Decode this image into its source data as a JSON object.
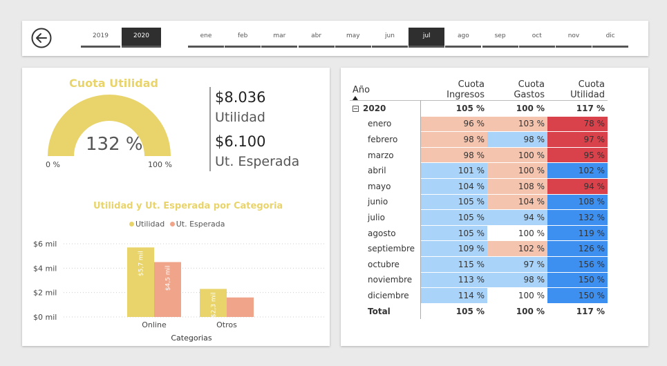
{
  "topbar": {
    "back_icon": "arrow-left-circle-icon",
    "years": [
      {
        "label": "2019",
        "selected": false
      },
      {
        "label": "2020",
        "selected": true
      }
    ],
    "months": [
      {
        "label": "ene",
        "selected": false
      },
      {
        "label": "feb",
        "selected": false
      },
      {
        "label": "mar",
        "selected": false
      },
      {
        "label": "abr",
        "selected": false
      },
      {
        "label": "may",
        "selected": false
      },
      {
        "label": "jun",
        "selected": false
      },
      {
        "label": "jul",
        "selected": true
      },
      {
        "label": "ago",
        "selected": false
      },
      {
        "label": "sep",
        "selected": false
      },
      {
        "label": "oct",
        "selected": false
      },
      {
        "label": "nov",
        "selected": false
      },
      {
        "label": "dic",
        "selected": false
      }
    ]
  },
  "gauge": {
    "title": "Cuota Utilidad",
    "value": "132 %",
    "min": "0 %",
    "max": "100 %",
    "fill_fraction": 1.0,
    "color": "#e8d46a"
  },
  "kpi": {
    "value1": "$8.036",
    "label1": "Utilidad",
    "value2": "$6.100",
    "label2": "Ut. Esperada"
  },
  "chart_data": {
    "type": "bar",
    "title": "Utilidad y Ut. Esperada por Categoria",
    "xlabel": "Categorias",
    "ylabel": "",
    "categories": [
      "Online",
      "Otros"
    ],
    "series": [
      {
        "name": "Utilidad",
        "values": [
          5.7,
          2.3
        ],
        "color": "#e8d46a",
        "labels": [
          "$5,7 mil",
          "$2,3 mil"
        ]
      },
      {
        "name": "Ut. Esperada",
        "values": [
          4.5,
          1.6
        ],
        "color": "#f0a58a",
        "labels": [
          "$4,5 mil",
          ""
        ]
      }
    ],
    "yticks": [
      "$0 mil",
      "$2 mil",
      "$4 mil",
      "$6 mil"
    ],
    "ytick_values": [
      0,
      2,
      4,
      6
    ],
    "ylim": [
      0,
      6.5
    ],
    "legend_position": "top-center"
  },
  "matrix": {
    "headers": {
      "row": "Año",
      "ing": "Cuota Ingresos",
      "gas": "Cuota Gastos",
      "uti": "Cuota Utilidad"
    },
    "year_row": {
      "label": "2020",
      "ing": "105 %",
      "gas": "100 %",
      "uti": "117 %"
    },
    "rows": [
      {
        "label": "enero",
        "ing": "96 %",
        "gas": "103 %",
        "uti": "78 %",
        "c_ing": "#f5c4ae",
        "c_gas": "#f5c4ae",
        "c_uti": "#d9414b"
      },
      {
        "label": "febrero",
        "ing": "98 %",
        "gas": "98 %",
        "uti": "97 %",
        "c_ing": "#f5c4ae",
        "c_gas": "#a9d3f8",
        "c_uti": "#d9414b"
      },
      {
        "label": "marzo",
        "ing": "98 %",
        "gas": "100 %",
        "uti": "95 %",
        "c_ing": "#f5c4ae",
        "c_gas": "#f5c4ae",
        "c_uti": "#d9414b"
      },
      {
        "label": "abril",
        "ing": "101 %",
        "gas": "100 %",
        "uti": "102 %",
        "c_ing": "#a9d3f8",
        "c_gas": "#f5c4ae",
        "c_uti": "#3d8ff0"
      },
      {
        "label": "mayo",
        "ing": "104 %",
        "gas": "108 %",
        "uti": "94 %",
        "c_ing": "#a9d3f8",
        "c_gas": "#f5c4ae",
        "c_uti": "#d9414b"
      },
      {
        "label": "junio",
        "ing": "105 %",
        "gas": "104 %",
        "uti": "108 %",
        "c_ing": "#a9d3f8",
        "c_gas": "#f5c4ae",
        "c_uti": "#3d8ff0"
      },
      {
        "label": "julio",
        "ing": "105 %",
        "gas": "94 %",
        "uti": "132 %",
        "c_ing": "#a9d3f8",
        "c_gas": "#a9d3f8",
        "c_uti": "#3d8ff0"
      },
      {
        "label": "agosto",
        "ing": "105 %",
        "gas": "100 %",
        "uti": "119 %",
        "c_ing": "#a9d3f8",
        "c_gas": "#ffffff",
        "c_uti": "#3d8ff0"
      },
      {
        "label": "septiembre",
        "ing": "109 %",
        "gas": "102 %",
        "uti": "126 %",
        "c_ing": "#a9d3f8",
        "c_gas": "#f5c4ae",
        "c_uti": "#3d8ff0"
      },
      {
        "label": "octubre",
        "ing": "115 %",
        "gas": "97 %",
        "uti": "156 %",
        "c_ing": "#a9d3f8",
        "c_gas": "#a9d3f8",
        "c_uti": "#3d8ff0"
      },
      {
        "label": "noviembre",
        "ing": "113 %",
        "gas": "98 %",
        "uti": "150 %",
        "c_ing": "#a9d3f8",
        "c_gas": "#a9d3f8",
        "c_uti": "#3d8ff0"
      },
      {
        "label": "diciembre",
        "ing": "114 %",
        "gas": "100 %",
        "uti": "150 %",
        "c_ing": "#a9d3f8",
        "c_gas": "#ffffff",
        "c_uti": "#3d8ff0"
      }
    ],
    "total_row": {
      "label": "Total",
      "ing": "105 %",
      "gas": "100 %",
      "uti": "117 %"
    },
    "collapse_icon": "minus-box-icon",
    "sort_icon": "sort-ascending-icon"
  }
}
